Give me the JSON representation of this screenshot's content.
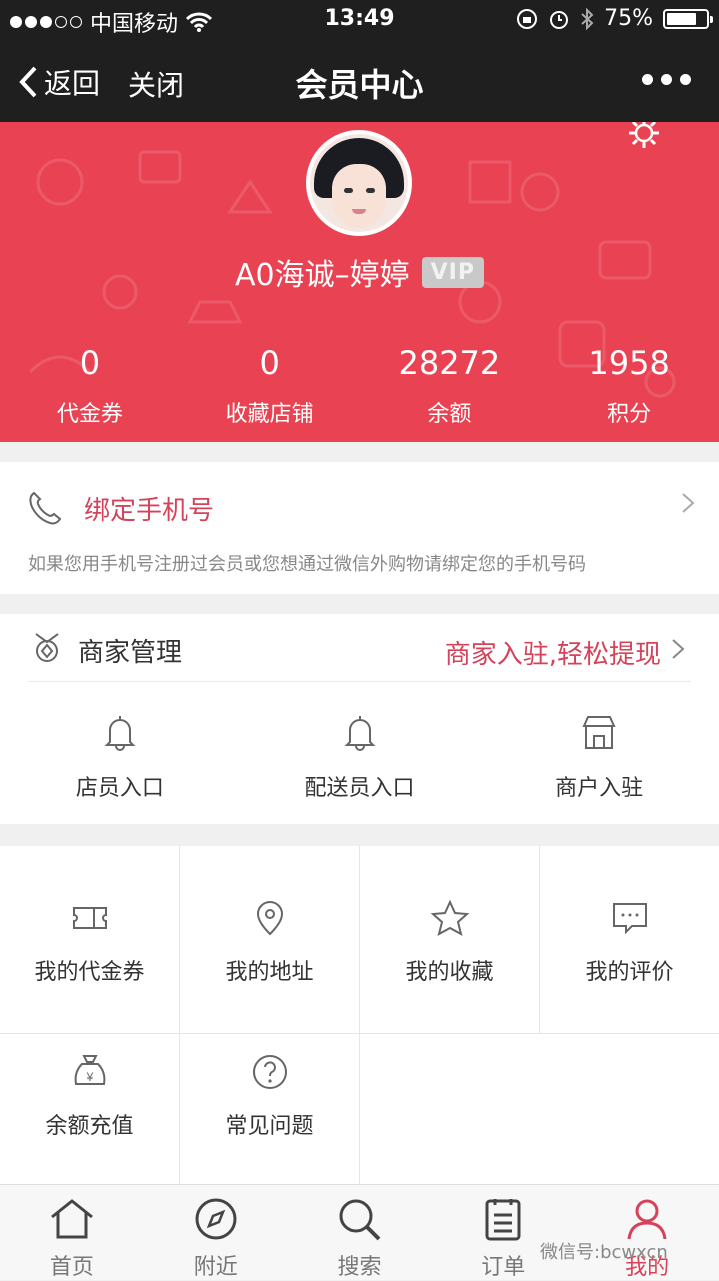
{
  "status_bar": {
    "carrier": "中国移动",
    "time": "13:49",
    "battery": "75%",
    "battery_level": 0.75
  },
  "nav": {
    "back_label": "返回",
    "close_label": "关闭",
    "title": "会员中心"
  },
  "profile": {
    "username": "A0海诚–婷婷",
    "badge": "VIP",
    "stats": [
      {
        "value": "0",
        "label": "代金券"
      },
      {
        "value": "0",
        "label": "收藏店铺"
      },
      {
        "value": "28272",
        "label": "余额"
      },
      {
        "value": "1958",
        "label": "积分"
      }
    ]
  },
  "bind_phone": {
    "title": "绑定手机号",
    "description": "如果您用手机号注册过会员或您想通过微信外购物请绑定您的手机号码"
  },
  "merchant": {
    "title": "商家管理",
    "link": "商家入驻,轻松提现",
    "items": [
      {
        "label": "店员入口",
        "icon": "bell-icon"
      },
      {
        "label": "配送员入口",
        "icon": "bell-icon"
      },
      {
        "label": "商户入驻",
        "icon": "store-icon"
      }
    ]
  },
  "menu": [
    {
      "label": "我的代金券",
      "icon": "ticket-icon"
    },
    {
      "label": "我的地址",
      "icon": "location-pin-icon"
    },
    {
      "label": "我的收藏",
      "icon": "star-icon"
    },
    {
      "label": "我的评价",
      "icon": "comment-icon"
    },
    {
      "label": "余额充值",
      "icon": "money-bag-icon"
    },
    {
      "label": "常见问题",
      "icon": "question-icon"
    }
  ],
  "tabs": [
    {
      "label": "首页",
      "icon": "home-icon"
    },
    {
      "label": "附近",
      "icon": "compass-icon"
    },
    {
      "label": "搜索",
      "icon": "search-icon"
    },
    {
      "label": "订单",
      "icon": "order-list-icon"
    },
    {
      "label": "我的",
      "icon": "user-icon",
      "active": true
    }
  ],
  "watermark": "微信号:bcwxcn",
  "colors": {
    "accent": "#e94353",
    "link": "#d4435a",
    "bar": "#1f1f1f"
  }
}
